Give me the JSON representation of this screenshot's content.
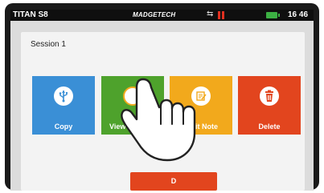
{
  "status_bar": {
    "device_name": "TITAN S8",
    "brand": "MADGETECH",
    "time": "16 46"
  },
  "dialog": {
    "title": "Session 1",
    "tiles": [
      {
        "label": "Copy",
        "icon": "usb-icon",
        "color": "#3a8fd6"
      },
      {
        "label": "View D",
        "icon": "view-icon",
        "color": "#4ea22c"
      },
      {
        "label": "dit Note",
        "icon": "note-icon",
        "color": "#f2a91c"
      },
      {
        "label": "Delete",
        "icon": "trash-icon",
        "color": "#e2451e"
      }
    ],
    "bottom_button": {
      "label": "D"
    }
  },
  "colors": {
    "status_bar": "#0f0f0f",
    "battery": "#3cb043",
    "alarm": "#e03020"
  }
}
